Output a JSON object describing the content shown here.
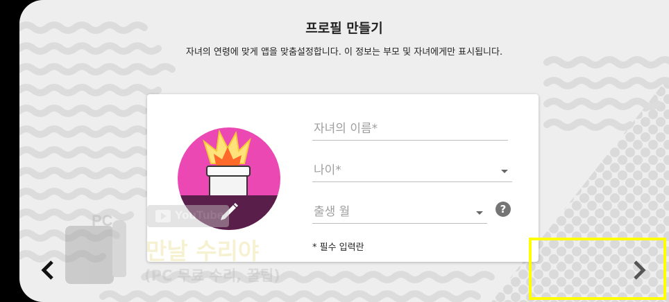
{
  "page": {
    "title": "프로필 만들기",
    "subtitle": "자녀의 연령에 맞게 앱을 맞춤설정합니다. 이 정보는 부모 및 자녀에게만 표시됩니다."
  },
  "form": {
    "name_placeholder": "자녀의 이름*",
    "age_placeholder": "나이*",
    "birth_month_placeholder": "출생 월",
    "required_note": "* 필수 입력란",
    "help_symbol": "?"
  },
  "watermark": {
    "youtube": "YouTube",
    "channel_name": "만날 수리야",
    "channel_sub": "(PC 무료 수리, 꿀팁)",
    "pc": "PC",
    "bottle_text": "수리야"
  },
  "icons": {
    "avatar": "flame-character-avatar",
    "edit": "pencil-icon",
    "prev": "chevron-left-icon",
    "next": "chevron-right-icon",
    "help": "help-circle-icon"
  },
  "colors": {
    "background": "#eeeeee",
    "card": "#ffffff",
    "avatar_bg": "#ec48b4",
    "highlight": "#ffff00"
  }
}
